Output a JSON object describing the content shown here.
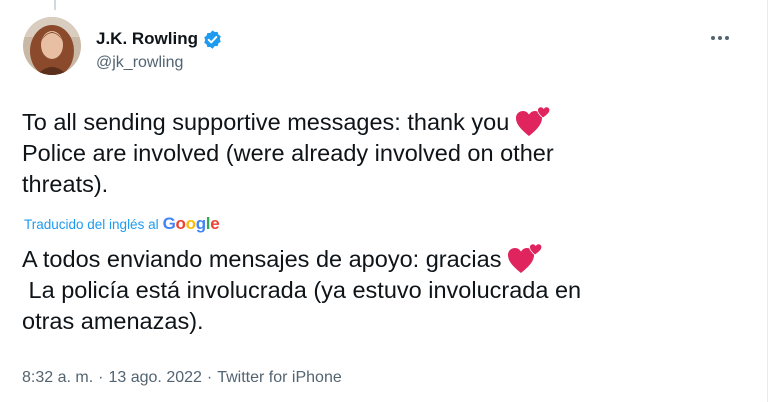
{
  "user": {
    "display_name": "J.K. Rowling",
    "handle": "@jk_rowling"
  },
  "icons": {
    "verified": "verified-badge-icon",
    "more": "more-horizontal-icon",
    "hearts": "two-hearts-icon",
    "avatar": "profile-photo"
  },
  "tweet": {
    "original_lines": [
      "To all sending supportive messages: thank you",
      "Police are involved (were already involved on other",
      "threats)."
    ],
    "translated_lines": [
      "A todos enviando mensajes de apoyo: gracias",
      " La policía está involucrada (ya estuvo involucrada en",
      "otras amenazas)."
    ]
  },
  "translation": {
    "label": "Traducido del inglés al",
    "google_letters": [
      "G",
      "o",
      "o",
      "g",
      "l",
      "e"
    ]
  },
  "meta": {
    "time": "8:32 a. m.",
    "separator": "·",
    "date": "13 ago. 2022",
    "source": "Twitter for iPhone"
  },
  "colors": {
    "accent": "#1d9bf0",
    "text": "#0f1419",
    "secondary": "#536471",
    "heart": "#e0245e",
    "google": [
      "#4285f4",
      "#ea4335",
      "#fbbc05",
      "#4285f4",
      "#34a853",
      "#ea4335"
    ]
  }
}
